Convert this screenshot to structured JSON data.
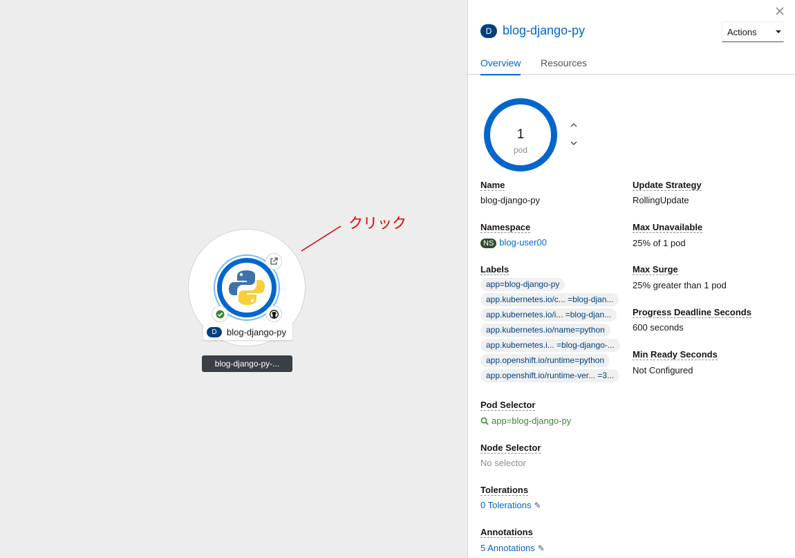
{
  "canvas": {
    "node_name": "blog-django-py",
    "node_kind_badge": "D",
    "tooltip": "blog-django-py-...",
    "annotation": "クリック"
  },
  "panel": {
    "kind_badge": "D",
    "title": "blog-django-py",
    "actions_label": "Actions",
    "tabs": [
      "Overview",
      "Resources"
    ],
    "active_tab": "Overview",
    "pods": {
      "count": "1",
      "unit": "pod"
    },
    "details_left": {
      "name": {
        "term": "Name",
        "value": "blog-django-py"
      },
      "namespace": {
        "term": "Namespace",
        "badge": "NS",
        "value": "blog-user00"
      },
      "labels": {
        "term": "Labels",
        "items": [
          "app=blog-django-py",
          "app.kubernetes.io/c... =blog-djan...",
          "app.kubernetes.io/i... =blog-djan...",
          "app.kubernetes.io/name=python",
          "app.kubernetes.i... =blog-django-...",
          "app.openshift.io/runtime=python",
          "app.openshift.io/runtime-ver... =3..."
        ]
      },
      "pod_selector": {
        "term": "Pod Selector",
        "value": "app=blog-django-py"
      },
      "node_selector": {
        "term": "Node Selector",
        "value": "No selector"
      },
      "tolerations": {
        "term": "Tolerations",
        "value": "0 Tolerations"
      },
      "annotations": {
        "term": "Annotations",
        "value": "5 Annotations"
      }
    },
    "details_right": {
      "update_strategy": {
        "term": "Update Strategy",
        "value": "RollingUpdate"
      },
      "max_unavailable": {
        "term": "Max Unavailable",
        "value": "25% of 1 pod"
      },
      "max_surge": {
        "term": "Max Surge",
        "value": "25% greater than 1 pod"
      },
      "progress_deadline": {
        "term": "Progress Deadline Seconds",
        "value": "600 seconds"
      },
      "min_ready": {
        "term": "Min Ready Seconds",
        "value": "Not Configured"
      }
    }
  },
  "colors": {
    "accent": "#0066cc",
    "deployment_badge": "#004080",
    "namespace_badge": "#2c4e2a",
    "annotation": "#e00000",
    "status_ok": "#3e8635"
  },
  "icons": [
    "python-logo-icon",
    "external-link-icon",
    "check-circle-icon",
    "github-icon",
    "close-icon",
    "caret-down-icon",
    "angle-up-icon",
    "angle-down-icon",
    "search-icon",
    "pencil-icon"
  ]
}
